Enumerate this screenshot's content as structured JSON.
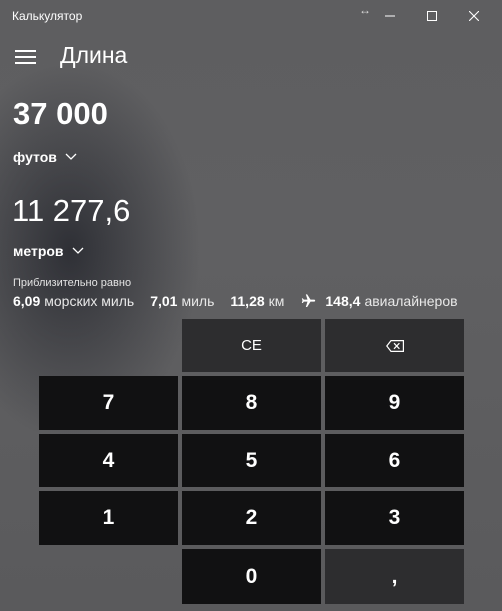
{
  "window": {
    "title": "Калькулятор",
    "resize_glyph": "↔"
  },
  "header": {
    "menu_icon": "hamburger-icon",
    "title": "Длина"
  },
  "converter": {
    "from_value": "37 000",
    "from_unit": "футов",
    "to_value": "11 277,6",
    "to_unit": "метров",
    "approx_label": "Приблизительно равно",
    "approx": [
      {
        "value": "6,09",
        "unit": "морских миль"
      },
      {
        "value": "7,01",
        "unit": "миль"
      },
      {
        "value": "11,28",
        "unit": "км"
      },
      {
        "value": "148,4",
        "unit": "авиалайнеров",
        "icon": "airplane-icon"
      }
    ]
  },
  "keypad": {
    "ce": "CE",
    "backspace_icon": "backspace-icon",
    "digits": {
      "d7": "7",
      "d8": "8",
      "d9": "9",
      "d4": "4",
      "d5": "5",
      "d6": "6",
      "d1": "1",
      "d2": "2",
      "d3": "3",
      "d0": "0"
    },
    "decimal": ","
  },
  "colors": {
    "background": "#5f5f61",
    "key_dark": "#111112",
    "key_gray": "#2d2d2f",
    "text": "#ffffff"
  }
}
